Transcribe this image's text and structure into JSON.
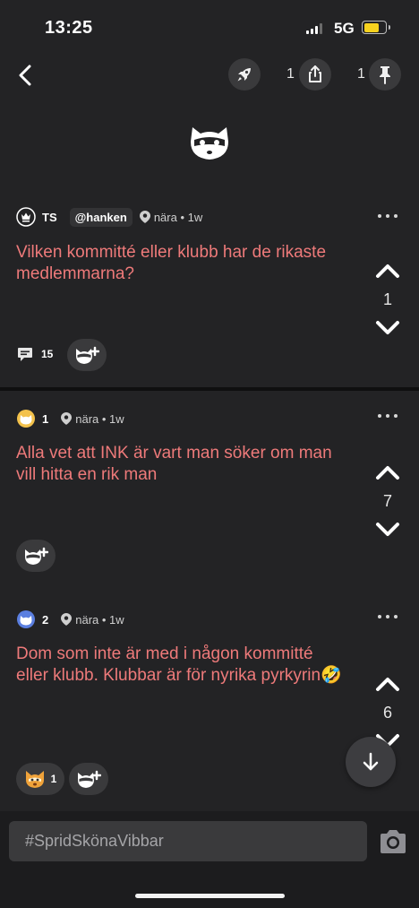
{
  "status_bar": {
    "time": "13:25",
    "network": "5G"
  },
  "header": {
    "rocket_icon": "rocket-icon",
    "share_count": "1",
    "pin_count": "1"
  },
  "posts": [
    {
      "author_badge": "TS",
      "handle": "@hanken",
      "location": "nära",
      "time": "1w",
      "text": "Vilken kommitté eller klubb har de rikaste medlemmarna?",
      "votes": "1",
      "comment_count": "15"
    },
    {
      "author_badge": "1",
      "location": "nära",
      "time": "1w",
      "text": "Alla vet att INK är vart man söker om man vill hitta en rik man",
      "votes": "7"
    },
    {
      "author_badge": "2",
      "location": "nära",
      "time": "1w",
      "text": "Dom som inte är med i någon kommitté eller klubb. Klubbar är för nyrika pyrkyrin🤣",
      "votes": "6",
      "reaction_count": "1"
    }
  ],
  "composer": {
    "placeholder": "#SpridSkönaVibbar"
  },
  "colors": {
    "background": "#232325",
    "post_text": "#ee7a7a",
    "button_bg": "#3a3a3c"
  }
}
